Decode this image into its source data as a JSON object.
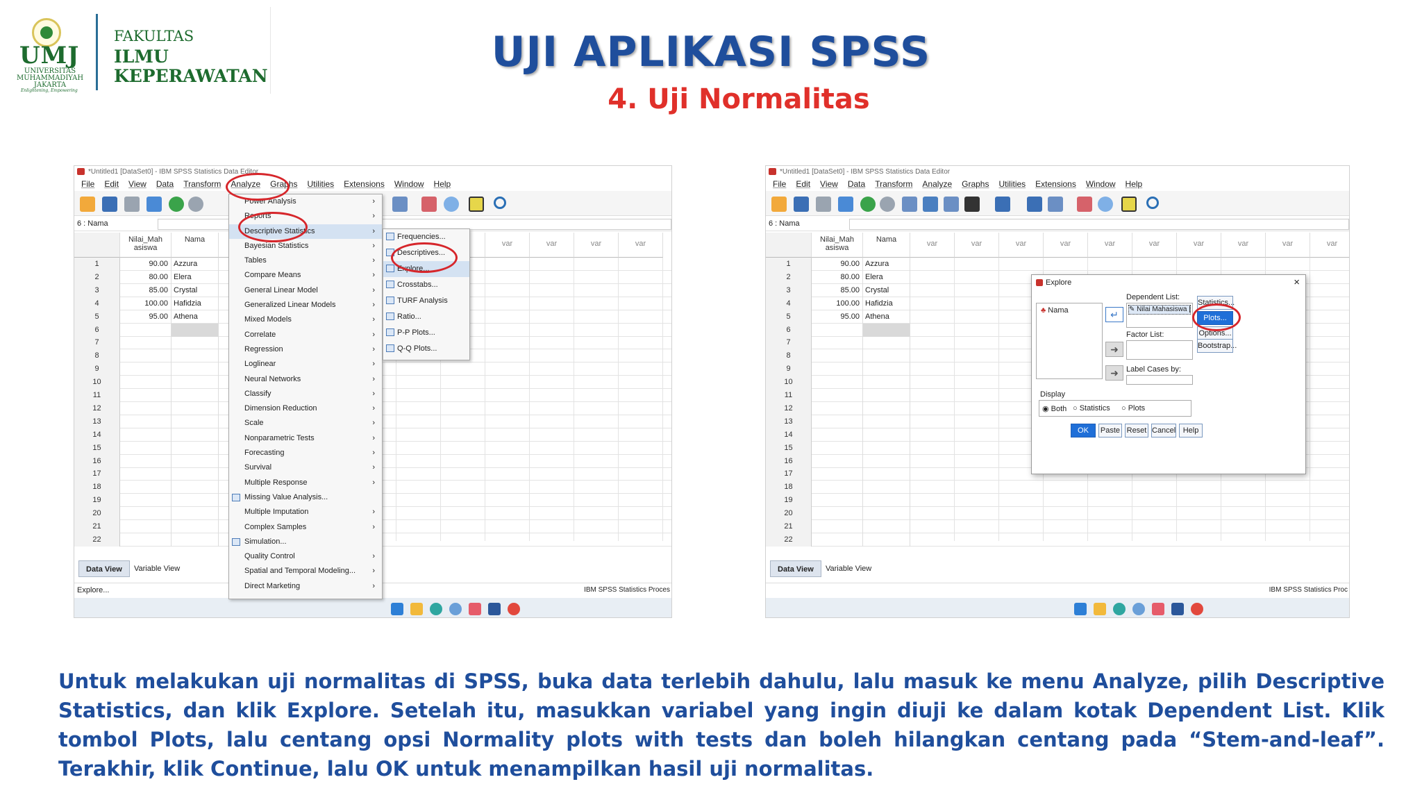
{
  "logo": {
    "abbr": "UMJ",
    "university": "UNIVERSITAS MUHAMMADIYAH JAKARTA",
    "tagline": "Enlightening, Empowering",
    "faculty_line1": "FAKULTAS",
    "faculty_line2": "ILMU",
    "faculty_line3": "KEPERAWATAN"
  },
  "title": "UJI APLIKASI SPSS",
  "subtitle": "4. Uji Normalitas",
  "spss": {
    "window_title_left": "*Untitled1 [DataSet0] - IBM SPSS Statistics Data Editor",
    "window_title_right": "*Untitled1 [DataSet0] - IBM SPSS Statistics Data Editor",
    "menus": [
      "File",
      "Edit",
      "View",
      "Data",
      "Transform",
      "Analyze",
      "Graphs",
      "Utilities",
      "Extensions",
      "Window",
      "Help"
    ],
    "cell_ref": "6 : Nama",
    "col1_header_a": "Nilai_Mah",
    "col1_header_b": "asiswa",
    "col2_header": "Nama",
    "var_label": "var",
    "rows": [
      {
        "n": "1",
        "v": "90.00",
        "name": "Azzura"
      },
      {
        "n": "2",
        "v": "80.00",
        "name": "Elera"
      },
      {
        "n": "3",
        "v": "85.00",
        "name": "Crystal"
      },
      {
        "n": "4",
        "v": "100.00",
        "name": "Hafidzia"
      },
      {
        "n": "5",
        "v": "95.00",
        "name": "Athena"
      },
      {
        "n": "6",
        "v": "",
        "name": ""
      },
      {
        "n": "7",
        "v": "",
        "name": ""
      },
      {
        "n": "8",
        "v": "",
        "name": ""
      },
      {
        "n": "9",
        "v": "",
        "name": ""
      },
      {
        "n": "10",
        "v": "",
        "name": ""
      },
      {
        "n": "11",
        "v": "",
        "name": ""
      },
      {
        "n": "12",
        "v": "",
        "name": ""
      },
      {
        "n": "13",
        "v": "",
        "name": ""
      },
      {
        "n": "14",
        "v": "",
        "name": ""
      },
      {
        "n": "15",
        "v": "",
        "name": ""
      },
      {
        "n": "16",
        "v": "",
        "name": ""
      },
      {
        "n": "17",
        "v": "",
        "name": ""
      },
      {
        "n": "18",
        "v": "",
        "name": ""
      },
      {
        "n": "19",
        "v": "",
        "name": ""
      },
      {
        "n": "20",
        "v": "",
        "name": ""
      },
      {
        "n": "21",
        "v": "",
        "name": ""
      },
      {
        "n": "22",
        "v": "",
        "name": ""
      }
    ],
    "tab_data_view": "Data View",
    "tab_variable_view": "Variable View",
    "status_left": "Explore...",
    "status_right_left": "IBM SPSS Statistics Proces",
    "status_right_right": "IBM SPSS Statistics Proc"
  },
  "analyze_menu": [
    {
      "label": "Power Analysis",
      "arrow": true
    },
    {
      "label": "Reports",
      "arrow": true
    },
    {
      "label": "Descriptive Statistics",
      "arrow": true,
      "highlight": true
    },
    {
      "label": "Bayesian Statistics",
      "arrow": true
    },
    {
      "label": "Tables",
      "arrow": true
    },
    {
      "label": "Compare Means",
      "arrow": true
    },
    {
      "label": "General Linear Model",
      "arrow": true
    },
    {
      "label": "Generalized Linear Models",
      "arrow": true
    },
    {
      "label": "Mixed Models",
      "arrow": true
    },
    {
      "label": "Correlate",
      "arrow": true
    },
    {
      "label": "Regression",
      "arrow": true
    },
    {
      "label": "Loglinear",
      "arrow": true
    },
    {
      "label": "Neural Networks",
      "arrow": true
    },
    {
      "label": "Classify",
      "arrow": true
    },
    {
      "label": "Dimension Reduction",
      "arrow": true
    },
    {
      "label": "Scale",
      "arrow": true
    },
    {
      "label": "Nonparametric Tests",
      "arrow": true
    },
    {
      "label": "Forecasting",
      "arrow": true
    },
    {
      "label": "Survival",
      "arrow": true
    },
    {
      "label": "Multiple Response",
      "arrow": true
    },
    {
      "label": "Missing Value Analysis...",
      "arrow": false,
      "icon": true
    },
    {
      "label": "Multiple Imputation",
      "arrow": true
    },
    {
      "label": "Complex Samples",
      "arrow": true
    },
    {
      "label": "Simulation...",
      "arrow": false,
      "icon": true
    },
    {
      "label": "Quality Control",
      "arrow": true
    },
    {
      "label": "Spatial and Temporal Modeling...",
      "arrow": true
    },
    {
      "label": "Direct Marketing",
      "arrow": true
    }
  ],
  "descriptive_submenu": [
    {
      "label": "Frequencies..."
    },
    {
      "label": "Descriptives..."
    },
    {
      "label": "Explore...",
      "highlight": true
    },
    {
      "label": "Crosstabs..."
    },
    {
      "label": "TURF Analysis"
    },
    {
      "label": "Ratio..."
    },
    {
      "label": "P-P Plots..."
    },
    {
      "label": "Q-Q Plots..."
    }
  ],
  "explore_dialog": {
    "title": "Explore",
    "source_var": "Nama",
    "dependent_label": "Dependent List:",
    "dependent_item": "Nilai Mahasiswa [",
    "factor_label": "Factor List:",
    "label_cases_label": "Label Cases by:",
    "display_label": "Display",
    "radio_both": "Both",
    "radio_statistics": "Statistics",
    "radio_plots": "Plots",
    "btn_statistics": "Statistics...",
    "btn_plots": "Plots...",
    "btn_options": "Options...",
    "btn_bootstrap": "Bootstrap...",
    "btn_ok": "OK",
    "btn_paste": "Paste",
    "btn_reset": "Reset",
    "btn_cancel": "Cancel",
    "btn_help": "Help"
  },
  "description": "Untuk melakukan uji normalitas di SPSS, buka data terlebih dahulu, lalu masuk ke menu Analyze, pilih Descriptive Statistics, dan klik Explore. Setelah itu, masukkan variabel yang ingin diuji ke dalam kotak Dependent List. Klik tombol Plots, lalu centang opsi Normality plots with tests dan boleh hilangkan centang pada “Stem-and-leaf”. Terakhir, klik Continue, lalu OK untuk menampilkan hasil uji normalitas.",
  "colors": {
    "title_blue": "#1f4e9c",
    "subtitle_red": "#e0302a",
    "annotation_red": "#d6262b",
    "logo_green": "#1d6b2e"
  }
}
